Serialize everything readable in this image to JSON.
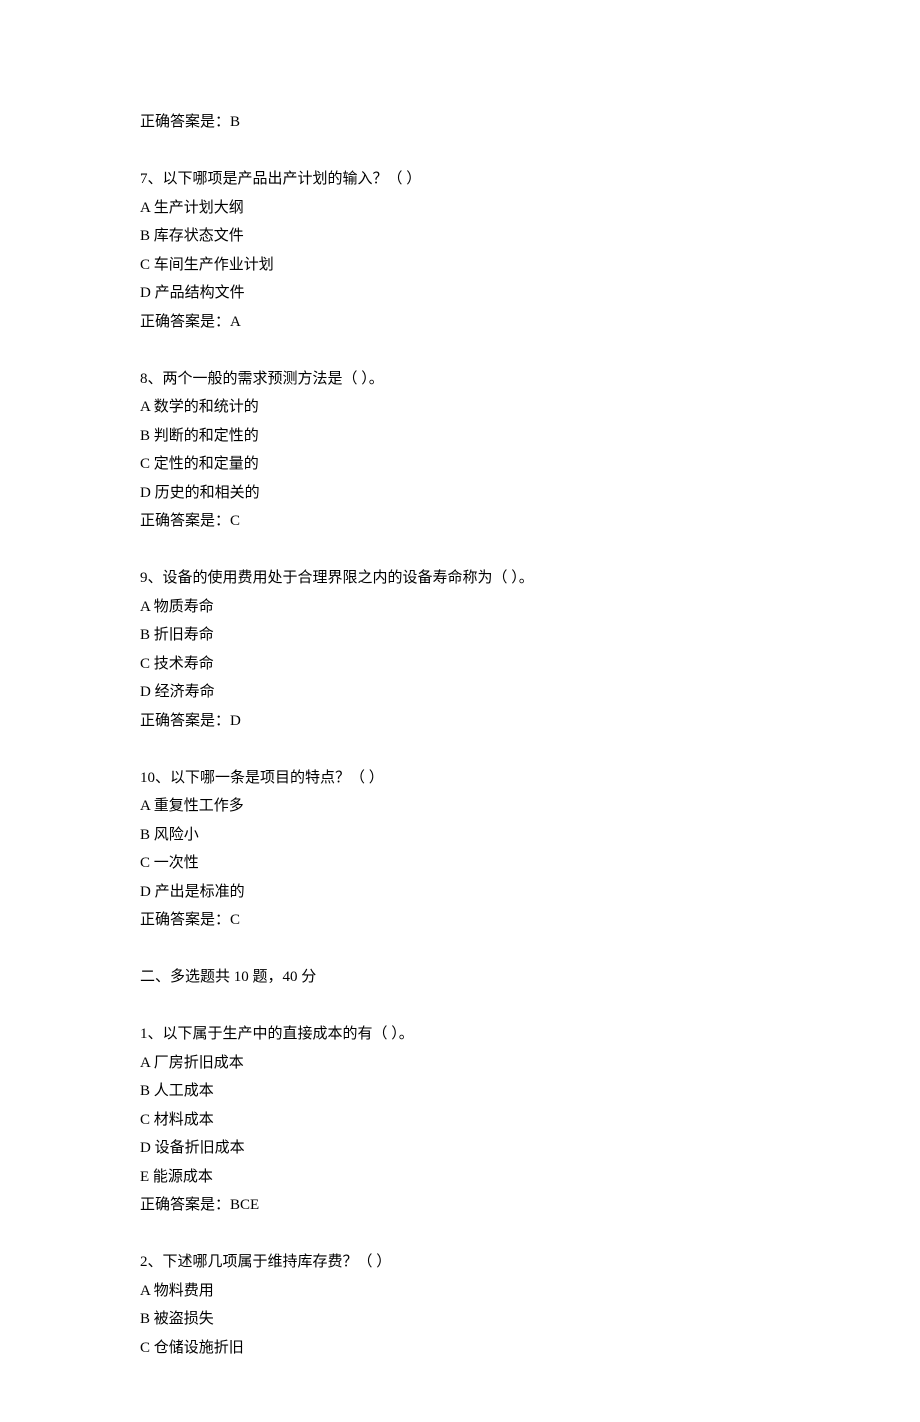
{
  "top_answer": "正确答案是：B",
  "questions": [
    {
      "q": "7、以下哪项是产品出产计划的输入？（ ）",
      "opts": [
        "A 生产计划大纲",
        "B 库存状态文件",
        "C 车间生产作业计划",
        "D 产品结构文件"
      ],
      "ans": "正确答案是：A"
    },
    {
      "q": "8、两个一般的需求预测方法是（ ）。",
      "opts": [
        "A 数学的和统计的",
        "B 判断的和定性的",
        "C 定性的和定量的",
        "D 历史的和相关的"
      ],
      "ans": "正确答案是：C"
    },
    {
      "q": "9、设备的使用费用处于合理界限之内的设备寿命称为（ ）。",
      "opts": [
        "A 物质寿命",
        "B 折旧寿命",
        "C 技术寿命",
        "D 经济寿命"
      ],
      "ans": "正确答案是：D"
    },
    {
      "q": "10、以下哪一条是项目的特点？（ ）",
      "opts": [
        "A 重复性工作多",
        "B 风险小",
        "C 一次性",
        "D 产出是标准的"
      ],
      "ans": "正确答案是：C"
    }
  ],
  "section2_title": "二、多选题共 10 题，40 分",
  "multi": [
    {
      "q": "1、以下属于生产中的直接成本的有（ ）。",
      "opts": [
        "A 厂房折旧成本",
        "B 人工成本",
        "C 材料成本",
        "D 设备折旧成本",
        "E 能源成本"
      ],
      "ans": "正确答案是：BCE"
    },
    {
      "q": "2、下述哪几项属于维持库存费？（ ）",
      "opts": [
        "A 物料费用",
        "B 被盗损失",
        "C 仓储设施折旧"
      ],
      "ans": null
    }
  ]
}
